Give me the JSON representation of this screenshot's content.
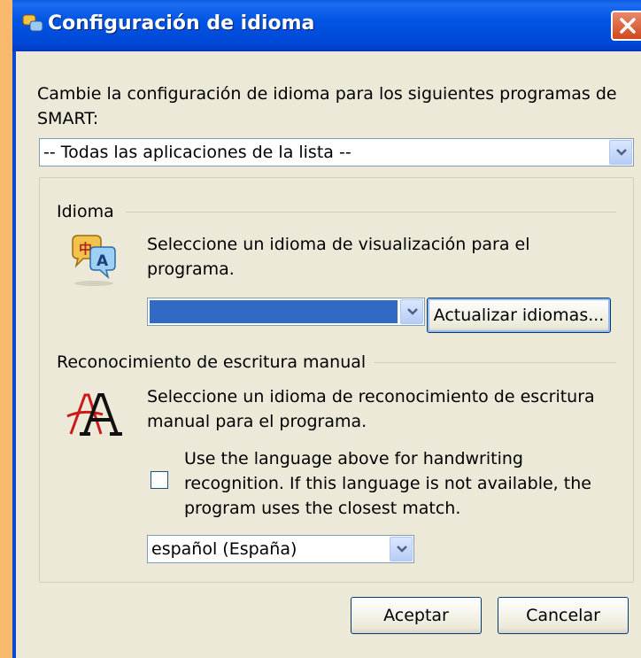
{
  "window": {
    "title": "Configuración de idioma",
    "close_label": "✕"
  },
  "intro": {
    "line1": "Cambie la configuración de idioma para los siguientes programas de",
    "line2": "SMART:"
  },
  "programs_select": {
    "selected": "-- Todas las aplicaciones de la lista --"
  },
  "language_section": {
    "label": "Idioma",
    "description_line1": "Seleccione un idioma de visualización para el",
    "description_line2": "programa.",
    "select_value": "",
    "update_button": "Actualizar idiomas..."
  },
  "handwriting_section": {
    "label": "Reconocimiento de escritura manual",
    "description_line1": "Seleccione un idioma de reconocimiento de escritura",
    "description_line2": "manual para el programa.",
    "checkbox_checked": false,
    "checkbox_line1": "Use the language above for handwriting",
    "checkbox_line2": "recognition. If this language is not available, the",
    "checkbox_line3": "program uses the closest match.",
    "select_value": "español (España)"
  },
  "footer": {
    "ok_button": "Aceptar",
    "cancel_button": "Cancelar"
  },
  "colors": {
    "titlebar": "#0054e3",
    "dialog_bg": "#ece9d8",
    "desktop_bg": "#f8b96c",
    "selection": "#316ac5",
    "close_button": "#d0481e"
  },
  "icons": {
    "title": "language-icon",
    "language_section": "language-speech-icon",
    "handwriting_section": "handwriting-aa-icon"
  }
}
